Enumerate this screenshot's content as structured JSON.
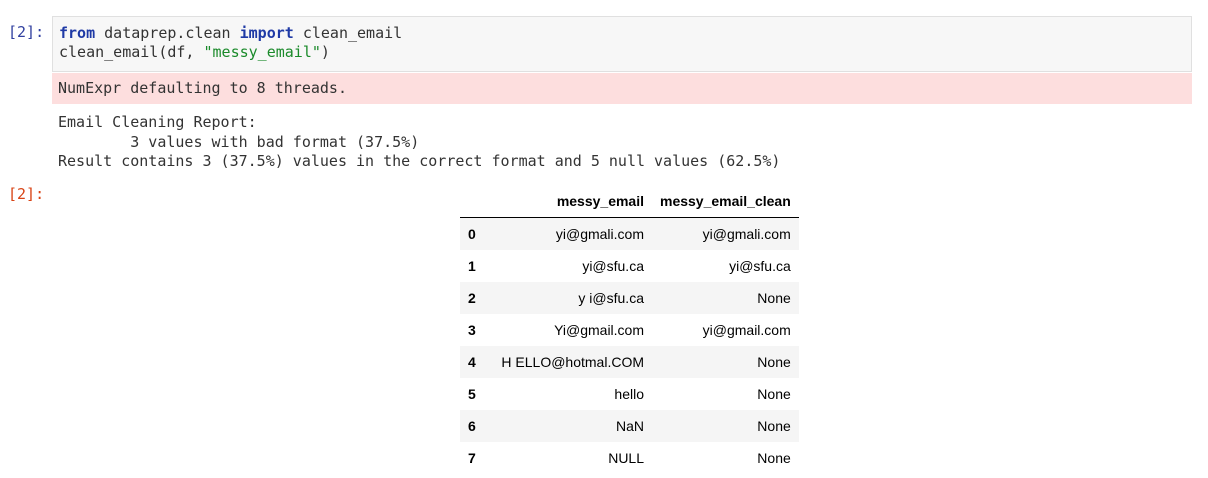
{
  "cell": {
    "in_prompt": "[2]:",
    "out_prompt": "[2]:",
    "code": {
      "line1": {
        "kw1": "from",
        "module": " dataprep.clean ",
        "kw2": "import",
        "name": " clean_email"
      },
      "line2": {
        "call": "clean_email(df, ",
        "str": "\"messy_email\"",
        "close": ")"
      }
    },
    "stderr": "NumExpr defaulting to 8 threads.",
    "stdout": [
      "Email Cleaning Report:",
      "        3 values with bad format (37.5%)",
      "Result contains 3 (37.5%) values in the correct format and 5 null values (62.5%)"
    ]
  },
  "table": {
    "columns": [
      "",
      "messy_email",
      "messy_email_clean"
    ],
    "rows": [
      {
        "index": "0",
        "messy_email": "yi@gmali.com",
        "messy_email_clean": "yi@gmali.com"
      },
      {
        "index": "1",
        "messy_email": "yi@sfu.ca",
        "messy_email_clean": "yi@sfu.ca"
      },
      {
        "index": "2",
        "messy_email": "y i@sfu.ca",
        "messy_email_clean": "None"
      },
      {
        "index": "3",
        "messy_email": "Yi@gmail.com",
        "messy_email_clean": "yi@gmail.com"
      },
      {
        "index": "4",
        "messy_email": "H ELLO@hotmal.COM",
        "messy_email_clean": "None"
      },
      {
        "index": "5",
        "messy_email": "hello",
        "messy_email_clean": "None"
      },
      {
        "index": "6",
        "messy_email": "NaN",
        "messy_email_clean": "None"
      },
      {
        "index": "7",
        "messy_email": "NULL",
        "messy_email_clean": "None"
      }
    ]
  },
  "colors": {
    "in_prompt": "#303f9f",
    "out_prompt": "#d84315",
    "keyword": "#1f3aa6",
    "string": "#1a8a2a",
    "stderr_bg": "#fddede"
  }
}
